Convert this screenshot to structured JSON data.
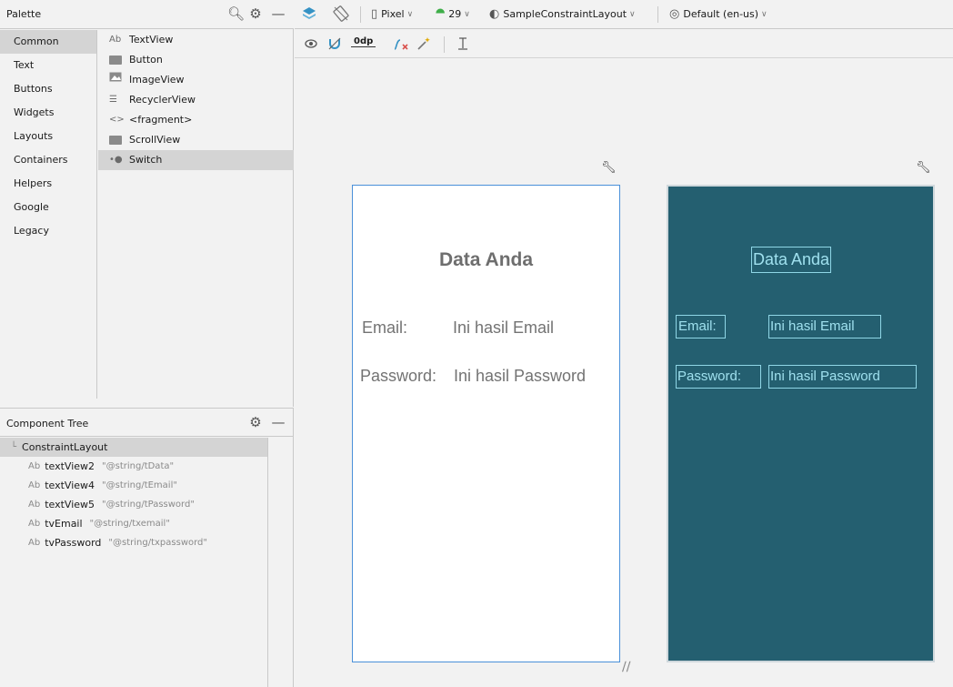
{
  "palette": {
    "title": "Palette",
    "categories": [
      "Common",
      "Text",
      "Buttons",
      "Widgets",
      "Layouts",
      "Containers",
      "Helpers",
      "Google",
      "Legacy"
    ],
    "widgets": [
      {
        "label": "TextView",
        "icon": "Ab"
      },
      {
        "label": "Button",
        "icon": "button-icon"
      },
      {
        "label": "ImageView",
        "icon": "image-icon"
      },
      {
        "label": "RecyclerView",
        "icon": "list-icon"
      },
      {
        "label": "<fragment>",
        "icon": "<>"
      },
      {
        "label": "ScrollView",
        "icon": "scroll-icon"
      },
      {
        "label": "Switch",
        "icon": "switch-icon"
      }
    ]
  },
  "tree": {
    "title": "Component Tree",
    "root": "ConstraintLayout",
    "nodes": [
      {
        "name": "textView2",
        "ref": "\"@string/tData\""
      },
      {
        "name": "textView4",
        "ref": "\"@string/tEmail\""
      },
      {
        "name": "textView5",
        "ref": "\"@string/tPassword\""
      },
      {
        "name": "tvEmail",
        "ref": "\"@string/txemail\""
      },
      {
        "name": "tvPassword",
        "ref": "\"@string/txpassword\""
      }
    ]
  },
  "toolbar": {
    "device": "Pixel",
    "api": "29",
    "theme": "SampleConstraintLayout",
    "locale": "Default (en-us)",
    "margin": "0dp"
  },
  "design": {
    "title": "Data Anda",
    "email_label": "Email:",
    "email_value": "Ini hasil Email",
    "password_label": "Password:",
    "password_value": "Ini hasil Password"
  },
  "colors": {
    "blueprint_bg": "#245f70",
    "selection_blue": "#4a90d9"
  }
}
